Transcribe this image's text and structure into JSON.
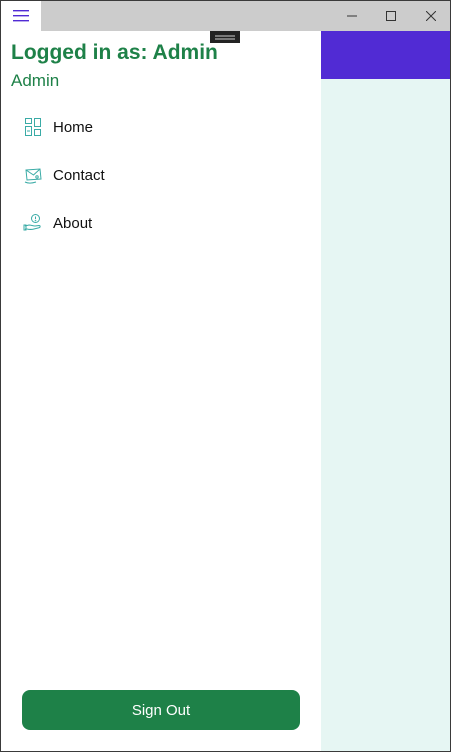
{
  "window": {
    "controls": {
      "menu_icon": "hamburger-menu-icon",
      "minimize_icon": "minimize-icon",
      "maximize_icon": "maximize-icon",
      "close_icon": "close-icon"
    }
  },
  "colors": {
    "accent_green": "#1e8148",
    "topbar_purple": "#512bd4",
    "content_bg": "#e6f6f3",
    "titlebar_bg": "#cccccc",
    "icon_teal": "#3aaba6"
  },
  "drawer": {
    "header": {
      "title": "Logged in as: Admin",
      "subtitle": "Admin"
    },
    "items": [
      {
        "label": "Home",
        "icon": "home-grid-icon"
      },
      {
        "label": "Contact",
        "icon": "contact-mail-icon"
      },
      {
        "label": "About",
        "icon": "about-hand-icon"
      }
    ],
    "signout_label": "Sign Out"
  }
}
